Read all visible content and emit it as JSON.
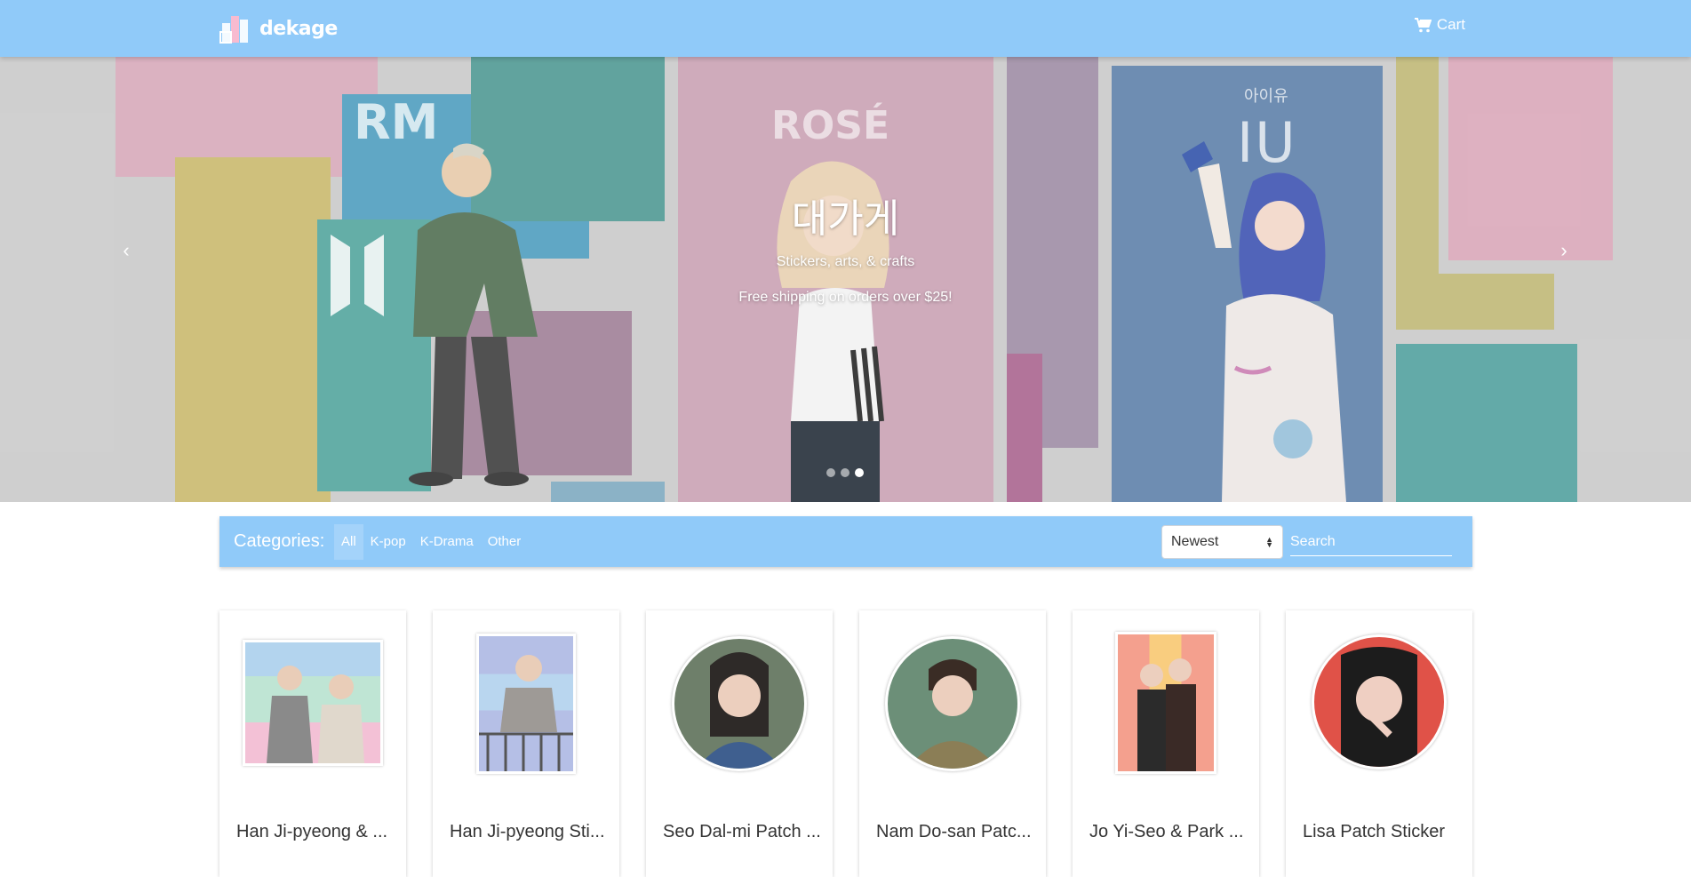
{
  "navbar": {
    "brand_name": "dekage",
    "cart_label": "Cart"
  },
  "hero": {
    "title": "대가게",
    "subtitle": "Stickers, arts, & crafts",
    "shipping_note": "Free shipping on orders over $25!",
    "prev_symbol": "‹",
    "next_symbol": "›",
    "slide_count": 3,
    "active_slide": 3,
    "art_labels": [
      "RM",
      "ROSÉ",
      "아이유",
      "IU"
    ]
  },
  "filters": {
    "categories_label": "Categories:",
    "categories": [
      "All",
      "K-pop",
      "K-Drama",
      "Other"
    ],
    "active_category": "All",
    "sort_value": "Newest",
    "search_placeholder": "Search"
  },
  "products": [
    {
      "title": "Han Ji-pyeong & ..."
    },
    {
      "title": "Han Ji-pyeong Sti..."
    },
    {
      "title": "Seo Dal-mi Patch ..."
    },
    {
      "title": "Nam Do-san Patc..."
    },
    {
      "title": "Jo Yi-Seo & Park ..."
    },
    {
      "title": "Lisa Patch Sticker"
    }
  ],
  "colors": {
    "navbar": "#90caf9",
    "text_white": "#ffffff",
    "card_title": "#333333"
  }
}
